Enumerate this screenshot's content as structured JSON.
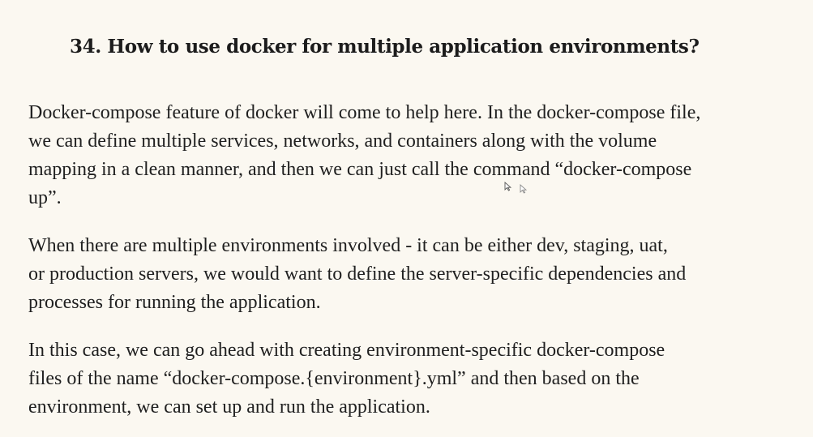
{
  "heading": "34. How to use docker for multiple application environments?",
  "paragraphs": [
    {
      "lines": [
        "Docker-compose feature of docker will come to help here. In the docker-compose file,",
        "we can define multiple services, networks, and containers along with the volume",
        "mapping in a clean manner, and then we can just call the command “docker-compose",
        "up”."
      ]
    },
    {
      "lines": [
        "When there are multiple environments involved - it can be either dev, staging, uat,",
        "or production servers, we would want to define the server-specific dependencies and",
        "processes for running the application."
      ]
    },
    {
      "lines": [
        "In this case, we can go ahead with creating environment-specific docker-compose",
        "files of the name “docker-compose.{environment}.yml” and then based on the",
        "environment, we can set up and run the application."
      ]
    }
  ],
  "icons": {
    "cursor": "mouse-pointer-icon"
  },
  "colors": {
    "background": "#fbf8f1",
    "text": "#202020"
  }
}
